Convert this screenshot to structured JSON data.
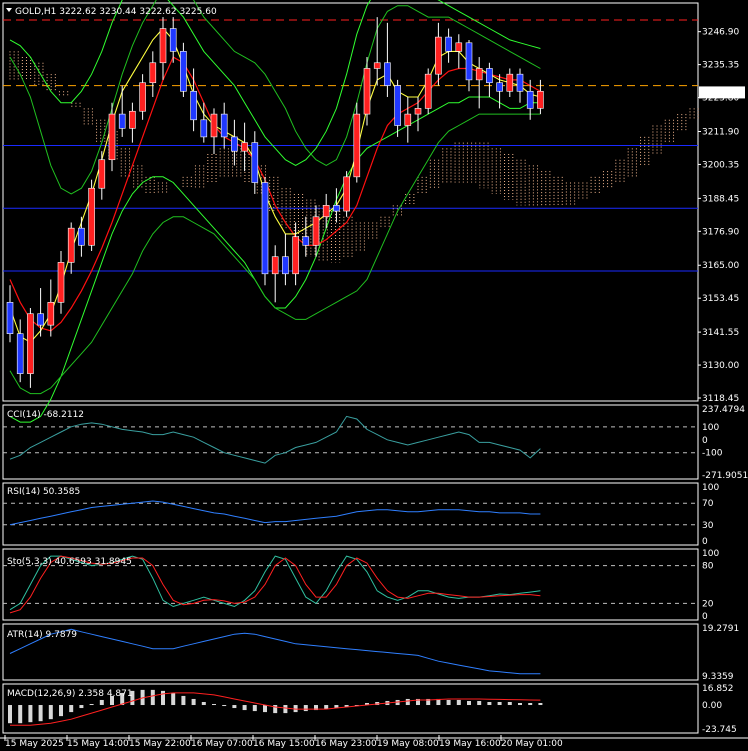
{
  "colors": {
    "bg": "#000000",
    "frame": "#ffffff",
    "bull": "#ff2020",
    "bear": "#2038ff",
    "wick": "#ffffff",
    "cloud": "#f4b890",
    "bb": "#20c020",
    "envelope": "#30ff30",
    "ma_red": "#ff1010",
    "ma_yellow": "#ffff40",
    "hline_red": "#ff2020",
    "hline_orange": "#ffa500",
    "hline_blue": "#1a2aff",
    "sub": "#2f7fff",
    "sig": "#ff2020",
    "dots": "#b0b0b0"
  },
  "chart_data": {
    "main": {
      "type": "line",
      "title": "GOLD,H1  3222.62 3230.44 3222.62 3225.60",
      "price_label": "3225.60",
      "ylim": [
        3118.45,
        3254.15
      ],
      "y_ticks": [
        "3246.90",
        "3235.35",
        "3223.80",
        "3211.90",
        "3200.35",
        "3188.45",
        "3176.90",
        "3165.00",
        "3153.45",
        "3141.55",
        "3130.00",
        "3118.45"
      ],
      "x_labels": [
        "15 May 2025",
        "15 May 14:00",
        "15 May 22:00",
        "16 May 07:00",
        "16 May 15:00",
        "16 May 23:00",
        "19 May 08:00",
        "19 May 16:00",
        "20 May 01:00"
      ],
      "hlines": [
        {
          "value": 3251,
          "style": "red"
        },
        {
          "value": 3228,
          "style": "orange"
        },
        {
          "value": 3207,
          "style": "blue"
        },
        {
          "value": 3185,
          "style": "blue"
        },
        {
          "value": 3163,
          "style": "blue"
        }
      ],
      "ohlc": [
        [
          3152,
          3158,
          3138,
          3141
        ],
        [
          3141,
          3146,
          3124,
          3127
        ],
        [
          3127,
          3150,
          3122,
          3148
        ],
        [
          3148,
          3157,
          3140,
          3144
        ],
        [
          3144,
          3160,
          3140,
          3152
        ],
        [
          3152,
          3170,
          3148,
          3166
        ],
        [
          3166,
          3180,
          3162,
          3178
        ],
        [
          3178,
          3182,
          3168,
          3172
        ],
        [
          3172,
          3195,
          3170,
          3192
        ],
        [
          3192,
          3205,
          3188,
          3202
        ],
        [
          3202,
          3222,
          3198,
          3218
        ],
        [
          3218,
          3228,
          3210,
          3213
        ],
        [
          3213,
          3222,
          3208,
          3219
        ],
        [
          3219,
          3232,
          3216,
          3229
        ],
        [
          3229,
          3240,
          3224,
          3236
        ],
        [
          3236,
          3252,
          3230,
          3248
        ],
        [
          3248,
          3252,
          3236,
          3240
        ],
        [
          3240,
          3243,
          3224,
          3226
        ],
        [
          3226,
          3234,
          3212,
          3216
        ],
        [
          3216,
          3222,
          3208,
          3210
        ],
        [
          3210,
          3220,
          3204,
          3218
        ],
        [
          3218,
          3222,
          3206,
          3210
        ],
        [
          3210,
          3216,
          3200,
          3205
        ],
        [
          3205,
          3215,
          3198,
          3208
        ],
        [
          3208,
          3212,
          3190,
          3194
        ],
        [
          3194,
          3196,
          3158,
          3162
        ],
        [
          3162,
          3172,
          3152,
          3168
        ],
        [
          3168,
          3176,
          3158,
          3162
        ],
        [
          3162,
          3180,
          3158,
          3175
        ],
        [
          3175,
          3182,
          3168,
          3172
        ],
        [
          3172,
          3186,
          3168,
          3182
        ],
        [
          3182,
          3190,
          3178,
          3186
        ],
        [
          3186,
          3192,
          3180,
          3184
        ],
        [
          3184,
          3198,
          3182,
          3196
        ],
        [
          3196,
          3222,
          3194,
          3218
        ],
        [
          3218,
          3238,
          3214,
          3234
        ],
        [
          3234,
          3252,
          3228,
          3236
        ],
        [
          3236,
          3250,
          3224,
          3228
        ],
        [
          3228,
          3230,
          3210,
          3214
        ],
        [
          3214,
          3224,
          3208,
          3218
        ],
        [
          3218,
          3224,
          3212,
          3220
        ],
        [
          3220,
          3234,
          3218,
          3232
        ],
        [
          3232,
          3250,
          3228,
          3245
        ],
        [
          3245,
          3248,
          3236,
          3240
        ],
        [
          3240,
          3246,
          3234,
          3243
        ],
        [
          3243,
          3244,
          3226,
          3230
        ],
        [
          3230,
          3238,
          3220,
          3234
        ],
        [
          3234,
          3236,
          3224,
          3229
        ],
        [
          3229,
          3232,
          3220,
          3226
        ],
        [
          3226,
          3234,
          3224,
          3232
        ],
        [
          3232,
          3234,
          3222,
          3226
        ],
        [
          3226,
          3230,
          3216,
          3220
        ],
        [
          3220,
          3230,
          3218,
          3226
        ]
      ],
      "ma_red": [
        3160,
        3152,
        3146,
        3143,
        3142,
        3145,
        3150,
        3156,
        3163,
        3171,
        3180,
        3190,
        3200,
        3210,
        3220,
        3230,
        3238,
        3236,
        3230,
        3222,
        3214,
        3210,
        3208,
        3206,
        3202,
        3195,
        3186,
        3180,
        3175,
        3172,
        3172,
        3174,
        3177,
        3180,
        3186,
        3196,
        3206,
        3214,
        3218,
        3220,
        3222,
        3226,
        3230,
        3233,
        3234,
        3234,
        3233,
        3232,
        3231,
        3230,
        3230,
        3228,
        3226
      ],
      "ma_yellow": [
        3150,
        3140,
        3138,
        3142,
        3148,
        3158,
        3170,
        3180,
        3190,
        3202,
        3215,
        3226,
        3232,
        3238,
        3244,
        3248,
        3244,
        3235,
        3225,
        3218,
        3214,
        3212,
        3210,
        3208,
        3202,
        3190,
        3182,
        3176,
        3176,
        3178,
        3180,
        3183,
        3186,
        3192,
        3205,
        3220,
        3230,
        3232,
        3226,
        3224,
        3224,
        3230,
        3238,
        3240,
        3240,
        3236,
        3234,
        3232,
        3230,
        3229,
        3228,
        3225,
        3224
      ],
      "bb_upper": [
        3238,
        3232,
        3224,
        3212,
        3200,
        3192,
        3190,
        3192,
        3198,
        3208,
        3220,
        3232,
        3242,
        3250,
        3256,
        3262,
        3264,
        3262,
        3258,
        3252,
        3248,
        3244,
        3240,
        3238,
        3236,
        3232,
        3226,
        3220,
        3212,
        3206,
        3202,
        3200,
        3202,
        3210,
        3222,
        3236,
        3248,
        3254,
        3256,
        3256,
        3254,
        3252,
        3252,
        3252,
        3250,
        3248,
        3246,
        3244,
        3242,
        3240,
        3238,
        3236,
        3234
      ],
      "bb_lower": [
        3128,
        3122,
        3120,
        3120,
        3122,
        3126,
        3130,
        3134,
        3138,
        3144,
        3150,
        3156,
        3162,
        3170,
        3176,
        3180,
        3182,
        3182,
        3180,
        3178,
        3176,
        3172,
        3168,
        3164,
        3160,
        3154,
        3150,
        3148,
        3146,
        3146,
        3148,
        3150,
        3152,
        3154,
        3156,
        3160,
        3168,
        3176,
        3184,
        3190,
        3196,
        3202,
        3208,
        3212,
        3214,
        3216,
        3218,
        3218,
        3218,
        3218,
        3218,
        3218,
        3218
      ],
      "env_upper": [
        3244,
        3242,
        3238,
        3232,
        3226,
        3222,
        3222,
        3226,
        3232,
        3240,
        3250,
        3258,
        3264,
        3266,
        3264,
        3260,
        3256,
        3252,
        3246,
        3240,
        3236,
        3232,
        3228,
        3222,
        3216,
        3210,
        3206,
        3202,
        3200,
        3202,
        3206,
        3212,
        3220,
        3232,
        3246,
        3256,
        3262,
        3264,
        3264,
        3264,
        3262,
        3260,
        3258,
        3256,
        3254,
        3252,
        3250,
        3248,
        3246,
        3244,
        3243,
        3242,
        3241
      ],
      "env_lower": [
        3112,
        3110,
        3110,
        3112,
        3118,
        3126,
        3136,
        3146,
        3156,
        3166,
        3176,
        3184,
        3190,
        3194,
        3196,
        3196,
        3194,
        3190,
        3186,
        3182,
        3178,
        3174,
        3170,
        3166,
        3160,
        3154,
        3150,
        3150,
        3154,
        3160,
        3168,
        3178,
        3188,
        3196,
        3202,
        3206,
        3208,
        3210,
        3212,
        3214,
        3216,
        3218,
        3220,
        3222,
        3222,
        3224,
        3224,
        3224,
        3222,
        3220,
        3220,
        3222,
        3222
      ],
      "cloud_a": [
        3240,
        3238,
        3236,
        3232,
        3226,
        3220,
        3214,
        3208,
        3202,
        3196,
        3192,
        3190,
        3190,
        3192,
        3196,
        3200,
        3204,
        3206,
        3206,
        3204,
        3200,
        3196,
        3192,
        3190,
        3188,
        3186,
        3184,
        3182,
        3180,
        3180,
        3182,
        3186,
        3190,
        3196,
        3202,
        3206,
        3208,
        3208,
        3208,
        3206,
        3204,
        3202,
        3200,
        3198,
        3196,
        3194,
        3194,
        3196,
        3198,
        3202,
        3206,
        3210,
        3214,
        3216,
        3218,
        3220
      ],
      "cloud_b": [
        3230,
        3230,
        3228,
        3226,
        3224,
        3222,
        3220,
        3216,
        3212,
        3206,
        3200,
        3196,
        3194,
        3192,
        3192,
        3192,
        3194,
        3196,
        3196,
        3194,
        3190,
        3184,
        3178,
        3172,
        3168,
        3166,
        3166,
        3168,
        3170,
        3174,
        3178,
        3182,
        3186,
        3190,
        3192,
        3194,
        3194,
        3194,
        3192,
        3190,
        3188,
        3186,
        3186,
        3186,
        3186,
        3186,
        3188,
        3190,
        3192,
        3194,
        3196,
        3200,
        3204,
        3208,
        3212,
        3216
      ]
    },
    "cci": {
      "label": "CCI(14) -68.2112",
      "ylim": [
        -271.9051,
        237.4794
      ],
      "ticks": [
        "237.4794",
        "100",
        "0",
        "-100",
        "-271.9051"
      ],
      "levels": [
        100,
        -100
      ],
      "values": [
        -150,
        -120,
        -60,
        -20,
        20,
        60,
        100,
        120,
        130,
        120,
        100,
        80,
        70,
        60,
        40,
        40,
        60,
        40,
        20,
        -20,
        -60,
        -100,
        -120,
        -140,
        -160,
        -180,
        -120,
        -100,
        -60,
        -40,
        -20,
        20,
        60,
        180,
        160,
        80,
        40,
        0,
        -20,
        -40,
        -20,
        0,
        20,
        40,
        60,
        40,
        -20,
        -20,
        -40,
        -60,
        -80,
        -140,
        -68
      ]
    },
    "rsi": {
      "label": "RSI(14) 50.3585",
      "ylim": [
        0,
        100
      ],
      "ticks": [
        "100",
        "70",
        "30",
        "0"
      ],
      "levels": [
        70,
        30
      ],
      "values": [
        30,
        34,
        38,
        42,
        46,
        50,
        54,
        58,
        62,
        64,
        66,
        68,
        70,
        72,
        74,
        72,
        68,
        64,
        60,
        56,
        52,
        50,
        46,
        42,
        38,
        34,
        36,
        36,
        38,
        40,
        42,
        44,
        46,
        50,
        54,
        56,
        58,
        58,
        56,
        54,
        54,
        56,
        58,
        58,
        58,
        56,
        54,
        54,
        52,
        52,
        52,
        50,
        50
      ]
    },
    "sto": {
      "label": "Sto(5,3,3) 40.6593 31.8945",
      "ylim": [
        0,
        100
      ],
      "ticks": [
        "100",
        "80",
        "20",
        "0"
      ],
      "levels": [
        80,
        20
      ],
      "main": [
        10,
        20,
        50,
        80,
        95,
        95,
        90,
        85,
        80,
        82,
        85,
        90,
        95,
        90,
        60,
        25,
        15,
        20,
        25,
        30,
        25,
        20,
        15,
        25,
        40,
        70,
        95,
        90,
        60,
        30,
        20,
        40,
        70,
        95,
        90,
        70,
        40,
        30,
        25,
        30,
        40,
        40,
        35,
        30,
        28,
        30,
        30,
        32,
        35,
        34,
        36,
        38,
        40
      ],
      "signal": [
        5,
        10,
        30,
        60,
        85,
        95,
        92,
        88,
        84,
        82,
        84,
        88,
        92,
        92,
        80,
        50,
        25,
        18,
        20,
        25,
        26,
        24,
        20,
        22,
        30,
        50,
        80,
        92,
        80,
        50,
        30,
        30,
        50,
        80,
        92,
        84,
        60,
        40,
        30,
        28,
        32,
        36,
        36,
        34,
        32,
        30,
        30,
        31,
        32,
        33,
        34,
        34,
        32
      ]
    },
    "atr": {
      "label": "ATR(14) 9.7879",
      "ylim": [
        9.3359,
        19.2791
      ],
      "ticks": [
        "19.2791",
        "9.3359"
      ],
      "values": [
        14,
        15,
        16,
        17,
        18,
        18.5,
        19,
        18.5,
        18,
        17.5,
        17,
        16.5,
        16,
        15.5,
        15,
        15,
        15,
        15.5,
        16,
        16.5,
        17,
        17.5,
        18,
        18.2,
        18,
        17.5,
        17,
        16.5,
        16,
        15.8,
        15.6,
        15.4,
        15.2,
        15,
        14.8,
        14.6,
        14.4,
        14.2,
        14,
        13.8,
        13.6,
        13,
        12.4,
        12,
        11.6,
        11.2,
        10.8,
        10.4,
        10.2,
        10,
        9.8,
        9.79,
        9.79
      ]
    },
    "macd": {
      "label": "MACD(12,26,9) 2.358 4.871",
      "ylim": [
        -23.745,
        16.852
      ],
      "ticks": [
        "16.852",
        "0.00",
        "-23.745"
      ],
      "hist": [
        -18,
        -18,
        -17,
        -16,
        -14,
        -11,
        -7,
        -3,
        1,
        5,
        9,
        12,
        14,
        15,
        15,
        14,
        12,
        9,
        6,
        3,
        1,
        -1,
        -3,
        -5,
        -6,
        -7,
        -8,
        -8,
        -7,
        -6,
        -5,
        -4,
        -3,
        -2,
        0,
        2,
        3,
        4,
        5,
        6,
        6,
        6,
        6,
        5,
        5,
        4,
        4,
        3,
        3,
        3,
        2,
        2,
        2
      ],
      "signal": [
        -20,
        -20,
        -20,
        -19,
        -18,
        -16,
        -14,
        -11,
        -8,
        -5,
        -2,
        1,
        4,
        7,
        9,
        11,
        12,
        12,
        12,
        11,
        10,
        8,
        6,
        4,
        2,
        0,
        -2,
        -3,
        -4,
        -4,
        -4,
        -4,
        -3,
        -2,
        -1,
        0,
        1,
        2,
        3,
        4,
        5,
        5,
        5.5,
        6,
        6,
        6,
        6,
        5.8,
        5.6,
        5.4,
        5.2,
        5,
        4.9
      ]
    }
  }
}
